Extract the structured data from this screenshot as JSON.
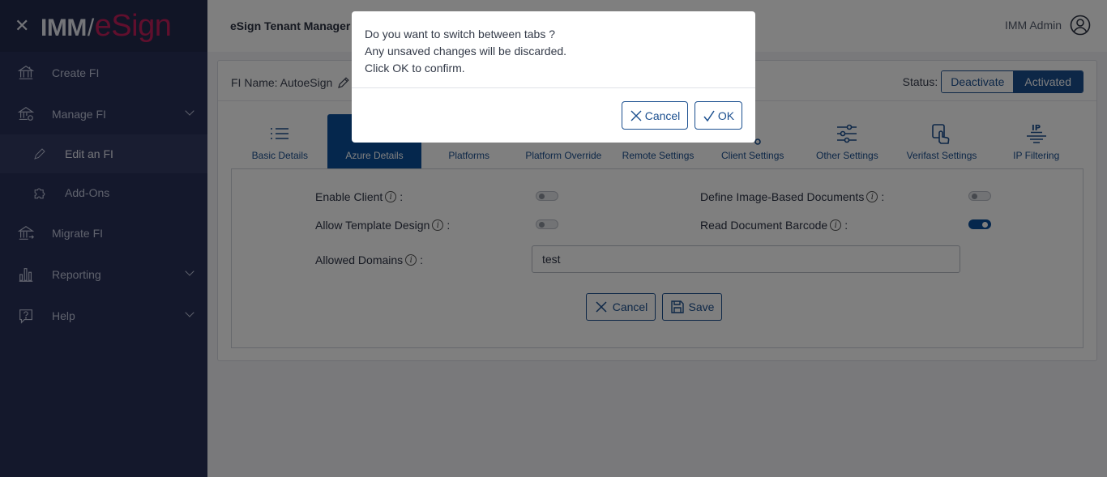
{
  "brand": {
    "imm": "IMM",
    "esign": "eSign"
  },
  "sidebar": {
    "items": [
      {
        "label": "Create FI",
        "icon": "bank-icon"
      },
      {
        "label": "Manage FI",
        "icon": "bank-settings-icon"
      },
      {
        "label": "Edit an FI",
        "icon": "pencil-icon"
      },
      {
        "label": "Add-Ons",
        "icon": "puzzle-icon"
      },
      {
        "label": "Migrate FI",
        "icon": "bank-migrate-icon"
      },
      {
        "label": "Reporting",
        "icon": "bar-chart-icon"
      },
      {
        "label": "Help",
        "icon": "help-icon"
      }
    ]
  },
  "header": {
    "title": "eSign Tenant Manager -",
    "user": "IMM Admin"
  },
  "card": {
    "fi_name": "FI Name: AutoeSign",
    "status_label": "Status:",
    "deactivate": "Deactivate",
    "activated": "Activated",
    "tabs": [
      {
        "label": "Basic Details",
        "icon": "list-icon",
        "active": false
      },
      {
        "label": "Azure Details",
        "icon": "azure-icon",
        "active": true
      },
      {
        "label": "Platforms",
        "icon": "platforms-icon",
        "active": false
      },
      {
        "label": "Platform Override",
        "icon": "override-icon",
        "active": false
      },
      {
        "label": "Remote Settings",
        "icon": "remote-icon",
        "active": false
      },
      {
        "label": "Client Settings",
        "icon": "client-settings-icon",
        "active": false
      },
      {
        "label": "Other Settings",
        "icon": "sliders-icon",
        "active": false
      },
      {
        "label": "Verifast Settings",
        "icon": "hand-touch-icon",
        "active": false
      },
      {
        "label": "IP Filtering",
        "icon": "ip-filter-icon",
        "active": false
      }
    ],
    "fields": {
      "enable_client": {
        "label": "Enable Client",
        "on": false
      },
      "allow_template_design": {
        "label": "Allow Template Design",
        "on": false
      },
      "define_image_docs": {
        "label": "Define Image-Based Documents",
        "on": false
      },
      "read_barcode": {
        "label": "Read Document Barcode",
        "on": true
      },
      "allowed_domains": {
        "label": "Allowed Domains",
        "value": "test"
      }
    },
    "colon": ":",
    "info_glyph": "i",
    "cancel": "Cancel",
    "save": "Save"
  },
  "modal": {
    "line1": "Do you want to switch between tabs ?",
    "line2": "Any unsaved changes will be discarded.",
    "line3": "Click OK to confirm.",
    "cancel": "Cancel",
    "ok": "OK"
  },
  "colors": {
    "sidebar": "#293158",
    "primary": "#0b4e9a",
    "brand_accent": "#c01f5a"
  }
}
